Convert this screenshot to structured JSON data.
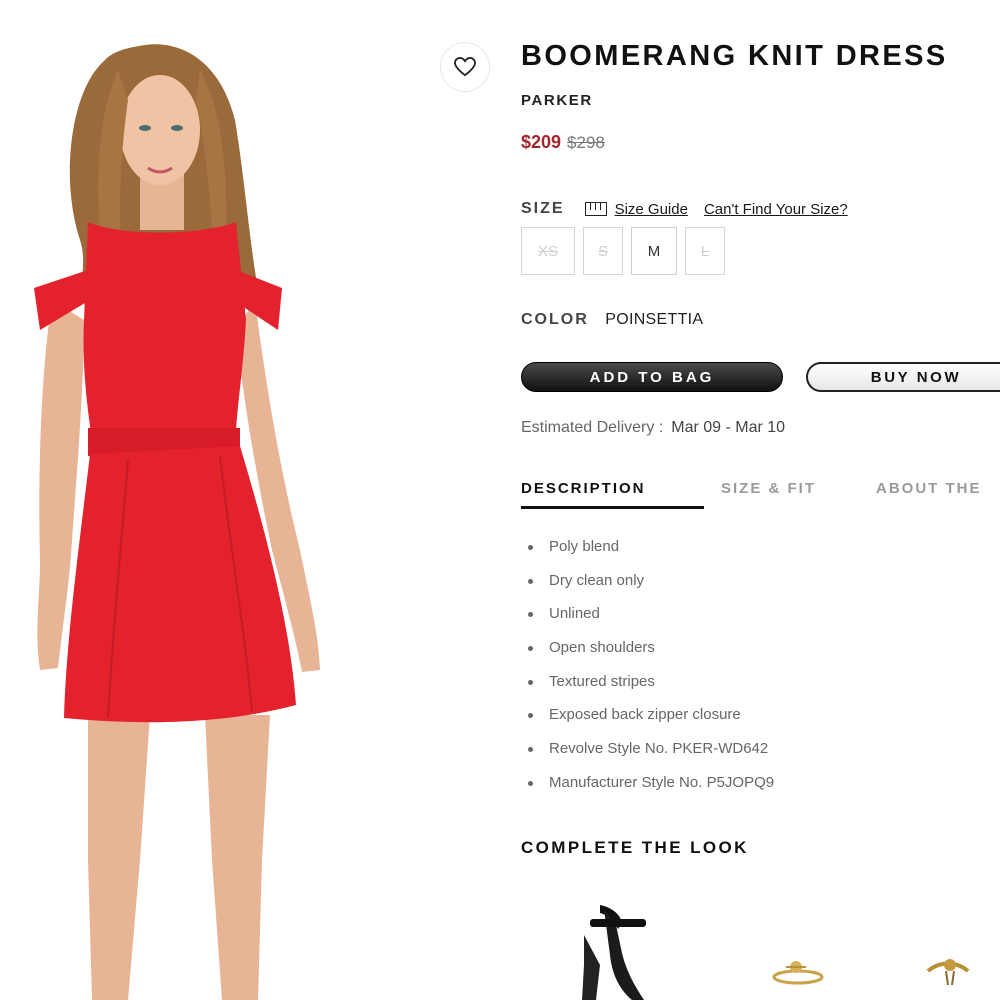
{
  "product": {
    "title": "BOOMERANG KNIT DRESS",
    "brand": "PARKER",
    "sale_price": "$209",
    "original_price": "$298"
  },
  "size": {
    "label": "SIZE",
    "guide_link": "Size Guide",
    "cant_find_link": "Can't Find Your Size?",
    "options": [
      {
        "label": "XS",
        "available": false
      },
      {
        "label": "S",
        "available": false
      },
      {
        "label": "M",
        "available": true
      },
      {
        "label": "L",
        "available": false
      }
    ]
  },
  "color": {
    "label": "COLOR",
    "value": "POINSETTIA"
  },
  "buttons": {
    "add_to_bag": "ADD TO BAG",
    "buy_now": "BUY NOW"
  },
  "delivery": {
    "label": "Estimated Delivery :",
    "dates": "Mar 09 - Mar 10"
  },
  "tabs": [
    {
      "label": "DESCRIPTION",
      "active": true
    },
    {
      "label": "SIZE & FIT",
      "active": false
    },
    {
      "label": "ABOUT THE",
      "active": false
    }
  ],
  "description_items": [
    "Poly blend",
    "Dry clean only",
    "Unlined",
    "Open shoulders",
    "Textured stripes",
    "Exposed back zipper closure",
    "Revolve Style No. PKER-WD642",
    "Manufacturer Style No. P5JOPQ9"
  ],
  "complete_the_look": {
    "title": "COMPLETE THE LOOK"
  },
  "icons": {
    "wishlist": "heart-icon",
    "size_guide": "ruler-icon"
  },
  "colors": {
    "sale_price": "#a3262e",
    "dress": "#e4222e",
    "text": "#1a1a1a"
  }
}
